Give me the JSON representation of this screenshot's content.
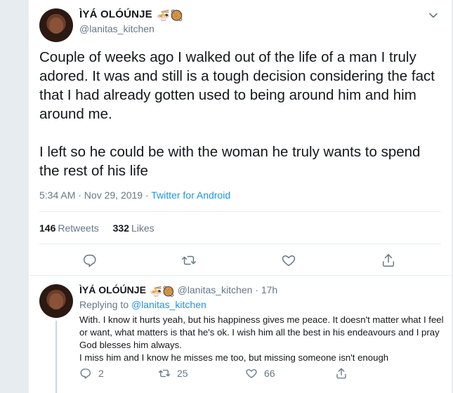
{
  "colors": {
    "accent": "#1b95e0",
    "muted": "#657786",
    "text": "#14171a",
    "border": "#e6ecf0"
  },
  "tweet": {
    "author_name": "ÌYÁ OLÓÚNJE",
    "author_emoji": "🍜🥘",
    "handle": "@lanitas_kitchen",
    "paragraphs": [
      "Couple of weeks ago I walked out of the life of a man I truly adored. It was and still is a tough decision considering the fact that I had already gotten used to being around him and him around me.",
      "I left so he could be with the woman he truly wants to spend the rest of his life"
    ],
    "time": "5:34 AM · Nov 29, 2019 ·",
    "source": "Twitter for Android",
    "retweets_count": "146",
    "retweets_label": "Retweets",
    "likes_count": "332",
    "likes_label": "Likes",
    "actions": [
      "reply-icon",
      "retweet-icon",
      "like-icon",
      "share-icon"
    ]
  },
  "reply": {
    "author_name": "ÌYÁ OLÓÚNJE",
    "author_emoji": "🍜🥘",
    "handle": "@lanitas_kitchen",
    "dot": "·",
    "time": "17h",
    "replying_to_label": "Replying to",
    "replying_to_handle": "@lanitas_kitchen",
    "lines": [
      "With. I know it hurts yeah, but his happiness gives me peace. It doesn't matter what I feel or want, what matters is that he's ok. I wish him all the best in his endeavours and I pray God blesses him always.",
      "I miss him and I know he misses me too, but missing someone isn't enough"
    ],
    "reply_count": "2",
    "retweet_count": "25",
    "like_count": "66"
  }
}
